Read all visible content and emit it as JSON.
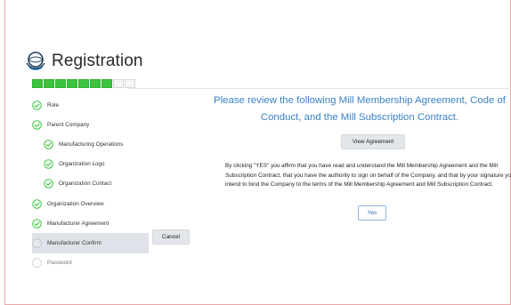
{
  "page": {
    "title": "Registration"
  },
  "progress": {
    "completed": 7,
    "total": 9
  },
  "steps": [
    {
      "label": "Role",
      "status": "done",
      "indent": false
    },
    {
      "label": "Parent Company",
      "status": "done",
      "indent": false
    },
    {
      "label": "Manufacturing Operations",
      "status": "done",
      "indent": true
    },
    {
      "label": "Organization Logo",
      "status": "done",
      "indent": true
    },
    {
      "label": "Organization Contact",
      "status": "done",
      "indent": true
    },
    {
      "label": "Organization Overview",
      "status": "done",
      "indent": false
    },
    {
      "label": "Manufacturer Agreement",
      "status": "done",
      "indent": false
    },
    {
      "label": "Manufacturer Confirm",
      "status": "current",
      "indent": false
    },
    {
      "label": "Password",
      "status": "pending",
      "indent": false
    }
  ],
  "actions": {
    "cancel_label": "Cancel"
  },
  "main": {
    "heading": "Please review the following Mill Membership Agreement, Code of Conduct, and the Mill Subscription Contract.",
    "view_label": "View Agreement",
    "paragraph": "By clicking \"YES\" you affirm that you have read and understand the Mill Membership Agreement and the Mill Subscription Contract, that you have the authority to sign on behalf of the Company, and that by your signature you intend to bind the Company to the terms of the Mill Membership Agreement and Mill Subscription Contract.",
    "yes_label": "Yes"
  },
  "colors": {
    "accent": "#3b82c4",
    "success": "#3cc43e",
    "active_row": "#dfe2e8"
  }
}
